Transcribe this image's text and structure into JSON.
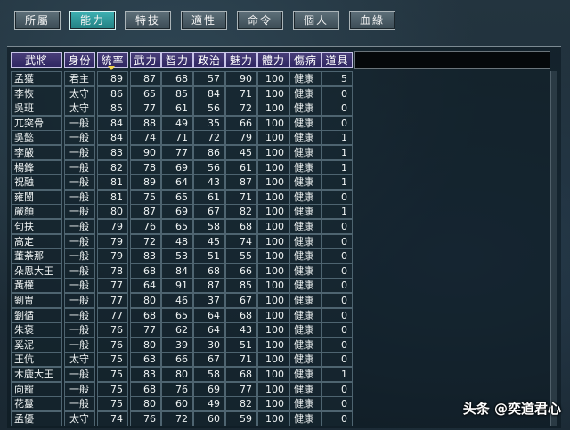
{
  "tabs": [
    {
      "label": "所屬",
      "active": false
    },
    {
      "label": "能力",
      "active": true
    },
    {
      "label": "特技",
      "active": false
    },
    {
      "label": "適性",
      "active": false
    },
    {
      "label": "命令",
      "active": false
    },
    {
      "label": "個人",
      "active": false
    },
    {
      "label": "血緣",
      "active": false
    }
  ],
  "columns": [
    "武將",
    "身份",
    "統率",
    "武力",
    "智力",
    "政治",
    "魅力",
    "體力",
    "傷病",
    "道具"
  ],
  "sorted_column": "統率",
  "rows": [
    [
      "孟獲",
      "君主",
      "89",
      "87",
      "68",
      "57",
      "90",
      "100",
      "健康",
      "5"
    ],
    [
      "李恢",
      "太守",
      "86",
      "65",
      "85",
      "84",
      "71",
      "100",
      "健康",
      "0"
    ],
    [
      "吳班",
      "太守",
      "85",
      "77",
      "61",
      "56",
      "72",
      "100",
      "健康",
      "0"
    ],
    [
      "兀突骨",
      "一般",
      "84",
      "88",
      "49",
      "35",
      "66",
      "100",
      "健康",
      "0"
    ],
    [
      "吳懿",
      "一般",
      "84",
      "74",
      "71",
      "72",
      "79",
      "100",
      "健康",
      "1"
    ],
    [
      "李嚴",
      "一般",
      "83",
      "90",
      "77",
      "86",
      "45",
      "100",
      "健康",
      "1"
    ],
    [
      "楊鋒",
      "一般",
      "82",
      "78",
      "69",
      "56",
      "61",
      "100",
      "健康",
      "1"
    ],
    [
      "祝融",
      "一般",
      "81",
      "89",
      "64",
      "43",
      "87",
      "100",
      "健康",
      "1"
    ],
    [
      "雍闓",
      "一般",
      "81",
      "75",
      "65",
      "61",
      "71",
      "100",
      "健康",
      "0"
    ],
    [
      "嚴顏",
      "一般",
      "80",
      "87",
      "69",
      "67",
      "82",
      "100",
      "健康",
      "1"
    ],
    [
      "句扶",
      "一般",
      "79",
      "76",
      "65",
      "58",
      "68",
      "100",
      "健康",
      "0"
    ],
    [
      "高定",
      "一般",
      "79",
      "72",
      "48",
      "45",
      "74",
      "100",
      "健康",
      "0"
    ],
    [
      "董荼那",
      "一般",
      "79",
      "83",
      "53",
      "51",
      "55",
      "100",
      "健康",
      "0"
    ],
    [
      "朵思大王",
      "一般",
      "78",
      "68",
      "84",
      "68",
      "66",
      "100",
      "健康",
      "0"
    ],
    [
      "黃權",
      "一般",
      "77",
      "64",
      "91",
      "87",
      "85",
      "100",
      "健康",
      "0"
    ],
    [
      "劉冑",
      "一般",
      "77",
      "80",
      "46",
      "37",
      "67",
      "100",
      "健康",
      "0"
    ],
    [
      "劉循",
      "一般",
      "77",
      "68",
      "65",
      "64",
      "68",
      "100",
      "健康",
      "0"
    ],
    [
      "朱褒",
      "一般",
      "76",
      "77",
      "62",
      "64",
      "43",
      "100",
      "健康",
      "0"
    ],
    [
      "奚泥",
      "一般",
      "76",
      "80",
      "39",
      "30",
      "51",
      "100",
      "健康",
      "0"
    ],
    [
      "王伉",
      "太守",
      "75",
      "63",
      "66",
      "67",
      "71",
      "100",
      "健康",
      "0"
    ],
    [
      "木鹿大王",
      "一般",
      "75",
      "83",
      "80",
      "58",
      "68",
      "100",
      "健康",
      "1"
    ],
    [
      "向寵",
      "一般",
      "75",
      "68",
      "76",
      "69",
      "77",
      "100",
      "健康",
      "0"
    ],
    [
      "花鬘",
      "一般",
      "75",
      "80",
      "60",
      "49",
      "82",
      "100",
      "健康",
      "0"
    ],
    [
      "孟優",
      "太守",
      "74",
      "76",
      "72",
      "60",
      "59",
      "100",
      "健康",
      "0"
    ]
  ],
  "watermark": "头条 @奕道君心"
}
